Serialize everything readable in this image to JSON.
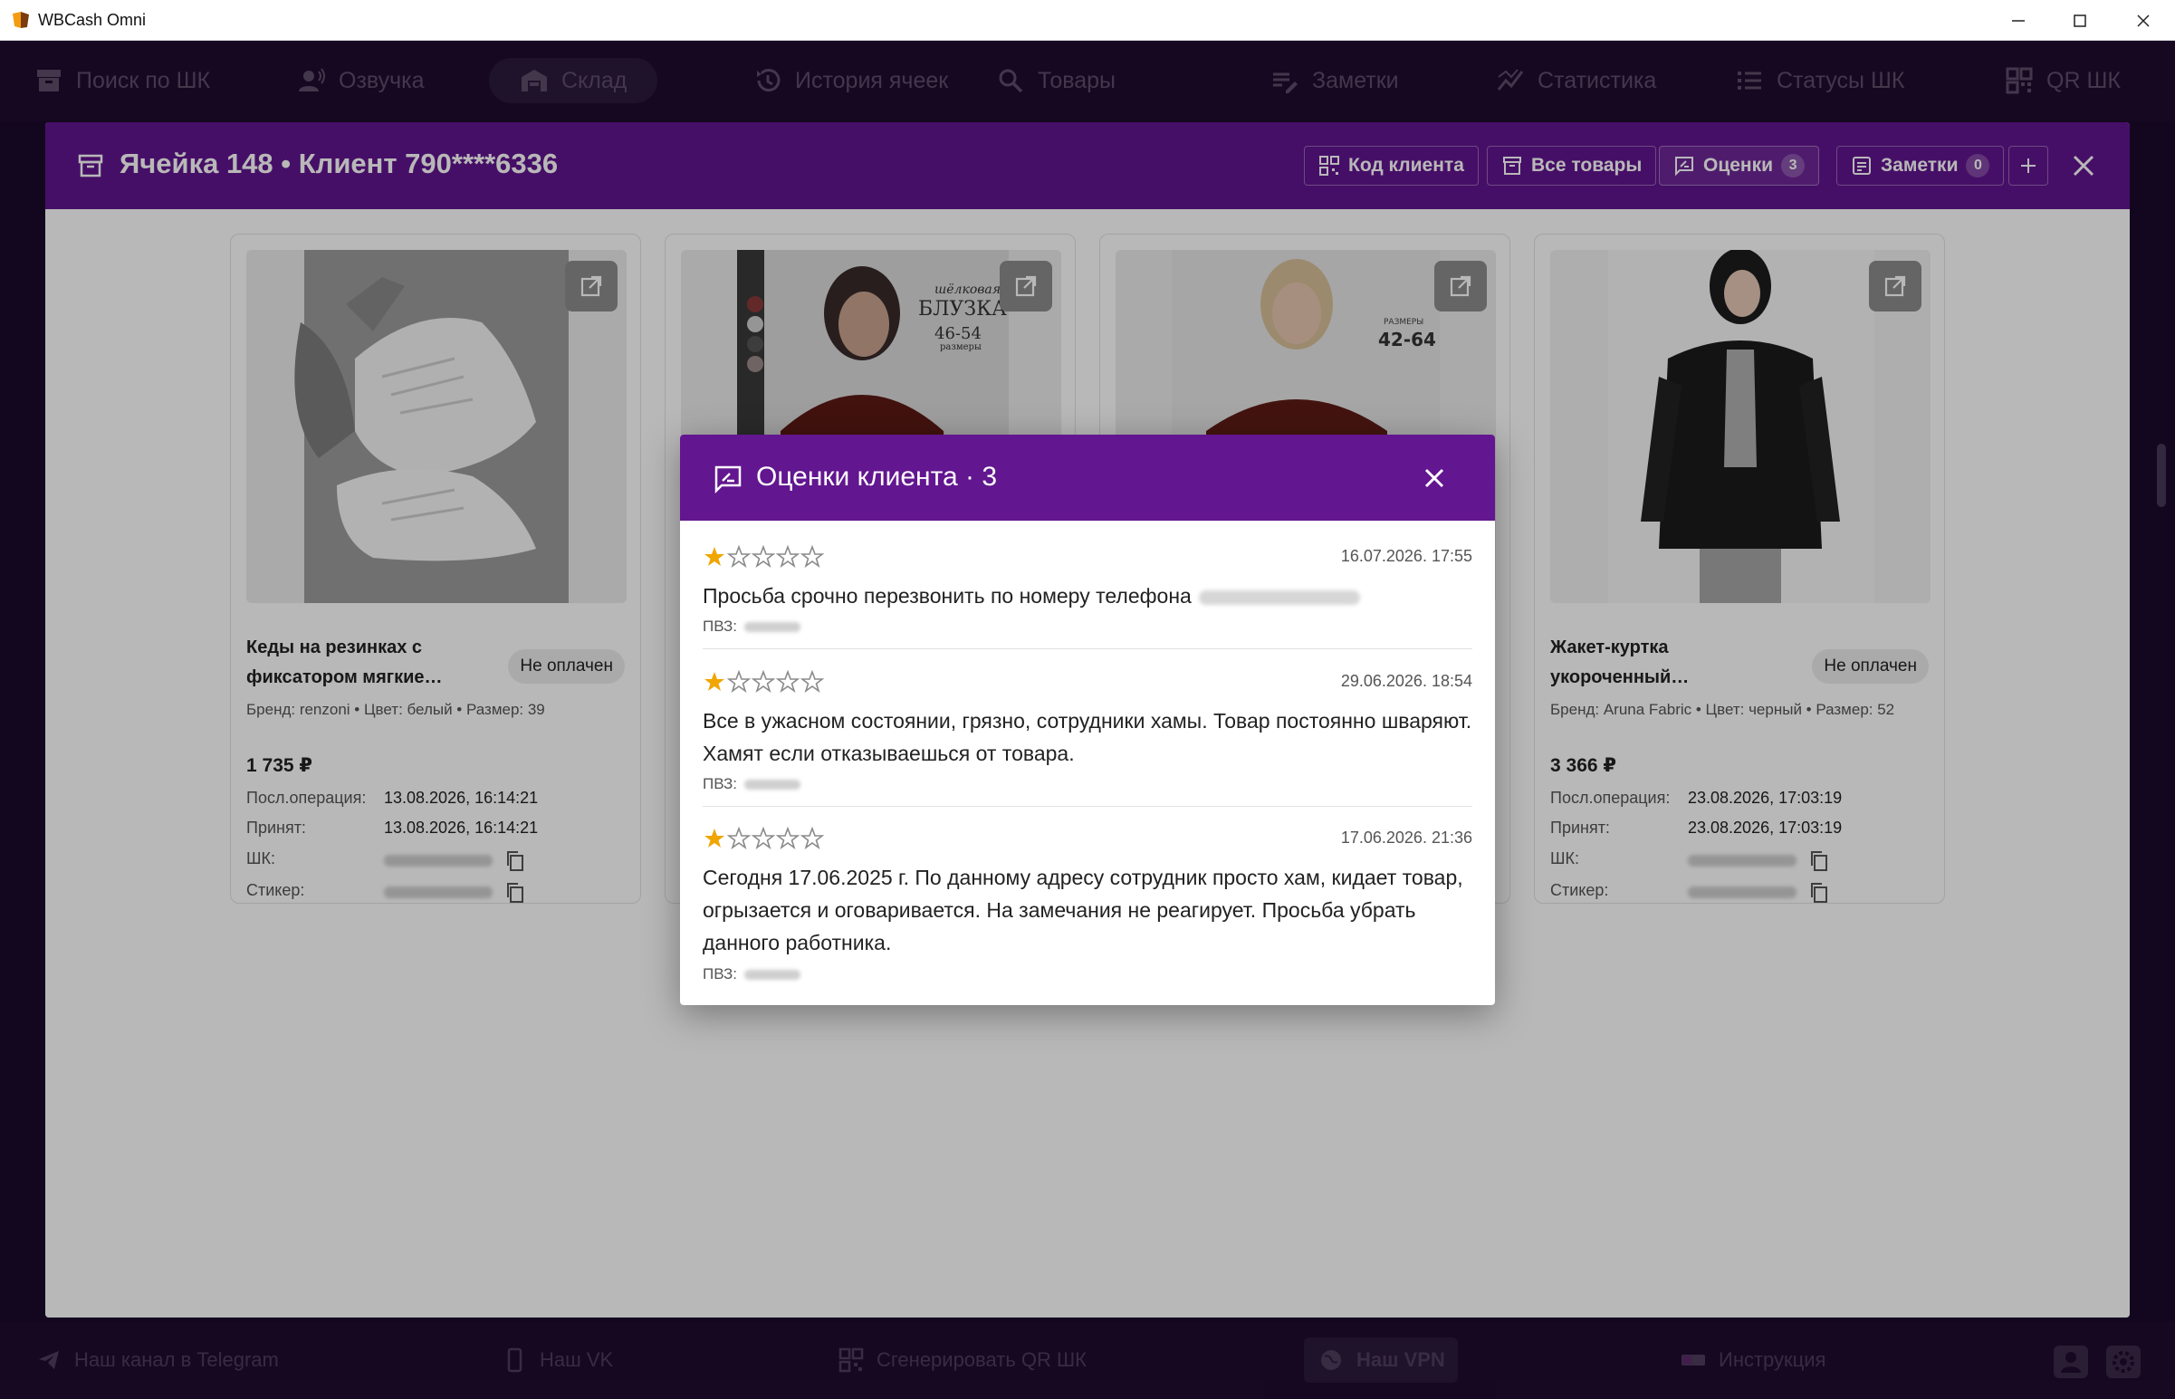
{
  "window": {
    "title": "WBCash Omni"
  },
  "nav": [
    {
      "label": "Поиск по ШК",
      "icon": "archive-icon"
    },
    {
      "label": "Озвучка",
      "icon": "voice-icon"
    },
    {
      "label": "Склад",
      "icon": "warehouse-icon",
      "active": true
    },
    {
      "label": "История ячеек",
      "icon": "history-icon"
    },
    {
      "label": "Товары",
      "icon": "search-icon"
    },
    {
      "label": "Заметки",
      "icon": "notes-icon"
    },
    {
      "label": "Статистика",
      "icon": "stats-icon"
    },
    {
      "label": "Статусы ШК",
      "icon": "list-icon"
    },
    {
      "label": "QR ШК",
      "icon": "qr-icon"
    }
  ],
  "cell": {
    "title": "Ячейка 148 • Клиент 790****6336",
    "client_code_label": "Код клиента",
    "all_goods_label": "Все товары",
    "ratings_label": "Оценки",
    "ratings_count": "3",
    "notes_label": "Заметки",
    "notes_count": "0"
  },
  "cards": [
    {
      "name": "Кеды на резинках с фиксатором мягкие…",
      "status": "Не оплачен",
      "meta": "Бренд: renzoni • Цвет: белый • Размер: 39",
      "price": "1 735 ₽",
      "op_label": "Посл.операция:",
      "op_value": "13.08.2026, 16:14:21",
      "accepted_label": "Принят:",
      "accepted_value": "13.08.2026, 16:14:21",
      "shk_label": "ШК:",
      "sticker_label": "Стикер:"
    },
    {
      "image_text_1": "шёлковая",
      "image_text_2": "БЛУЗКА",
      "image_text_3": "46-54",
      "image_text_4": "размеры"
    },
    {
      "image_text_1": "РАЗМЕРЫ",
      "image_text_2": "42-64"
    },
    {
      "name": "Жакет-куртка укороченный…",
      "status": "Не оплачен",
      "meta": "Бренд: Aruna Fabric • Цвет: черный • Размер: 52",
      "price": "3 366 ₽",
      "op_label": "Посл.операция:",
      "op_value": "23.08.2026, 17:03:19",
      "accepted_label": "Принят:",
      "accepted_value": "23.08.2026, 17:03:19",
      "shk_label": "ШК:",
      "sticker_label": "Стикер:"
    }
  ],
  "modal": {
    "title": "Оценки клиента · 3",
    "reviews": [
      {
        "rating": 1,
        "date": "16.07.2026. 17:55",
        "text": "Просьба срочно перезвонить по номеру телефона",
        "pvz_label": "ПВЗ:"
      },
      {
        "rating": 1,
        "date": "29.06.2026. 18:54",
        "text": "Все в ужасном состоянии, грязно, сотрудники хамы. Товар постоянно шваряют. Хамят если  отказываешься от товара.",
        "pvz_label": "ПВЗ:"
      },
      {
        "rating": 1,
        "date": "17.06.2026. 21:36",
        "text": "Сегодня 17.06.2025 г. По данному адресу сотрудник просто хам, кидает товар, огрызается и оговаривается. На замечания не реагирует.  Просьба убрать данного работника.",
        "pvz_label": "ПВЗ:"
      }
    ]
  },
  "footer": [
    {
      "label": "Наш канал в Telegram",
      "icon": "telegram-icon"
    },
    {
      "label": "Наш VK",
      "icon": "phone-icon"
    },
    {
      "label": "Сгенерировать QR ШК",
      "icon": "qr-icon"
    },
    {
      "label": "Наш VPN",
      "icon": "globe-icon"
    },
    {
      "label": "Инструкция",
      "icon": "toggle-icon"
    }
  ],
  "colors": {
    "accent": "#62168f",
    "nav_bg": "#1f0c2e",
    "star": "#f0a500"
  }
}
